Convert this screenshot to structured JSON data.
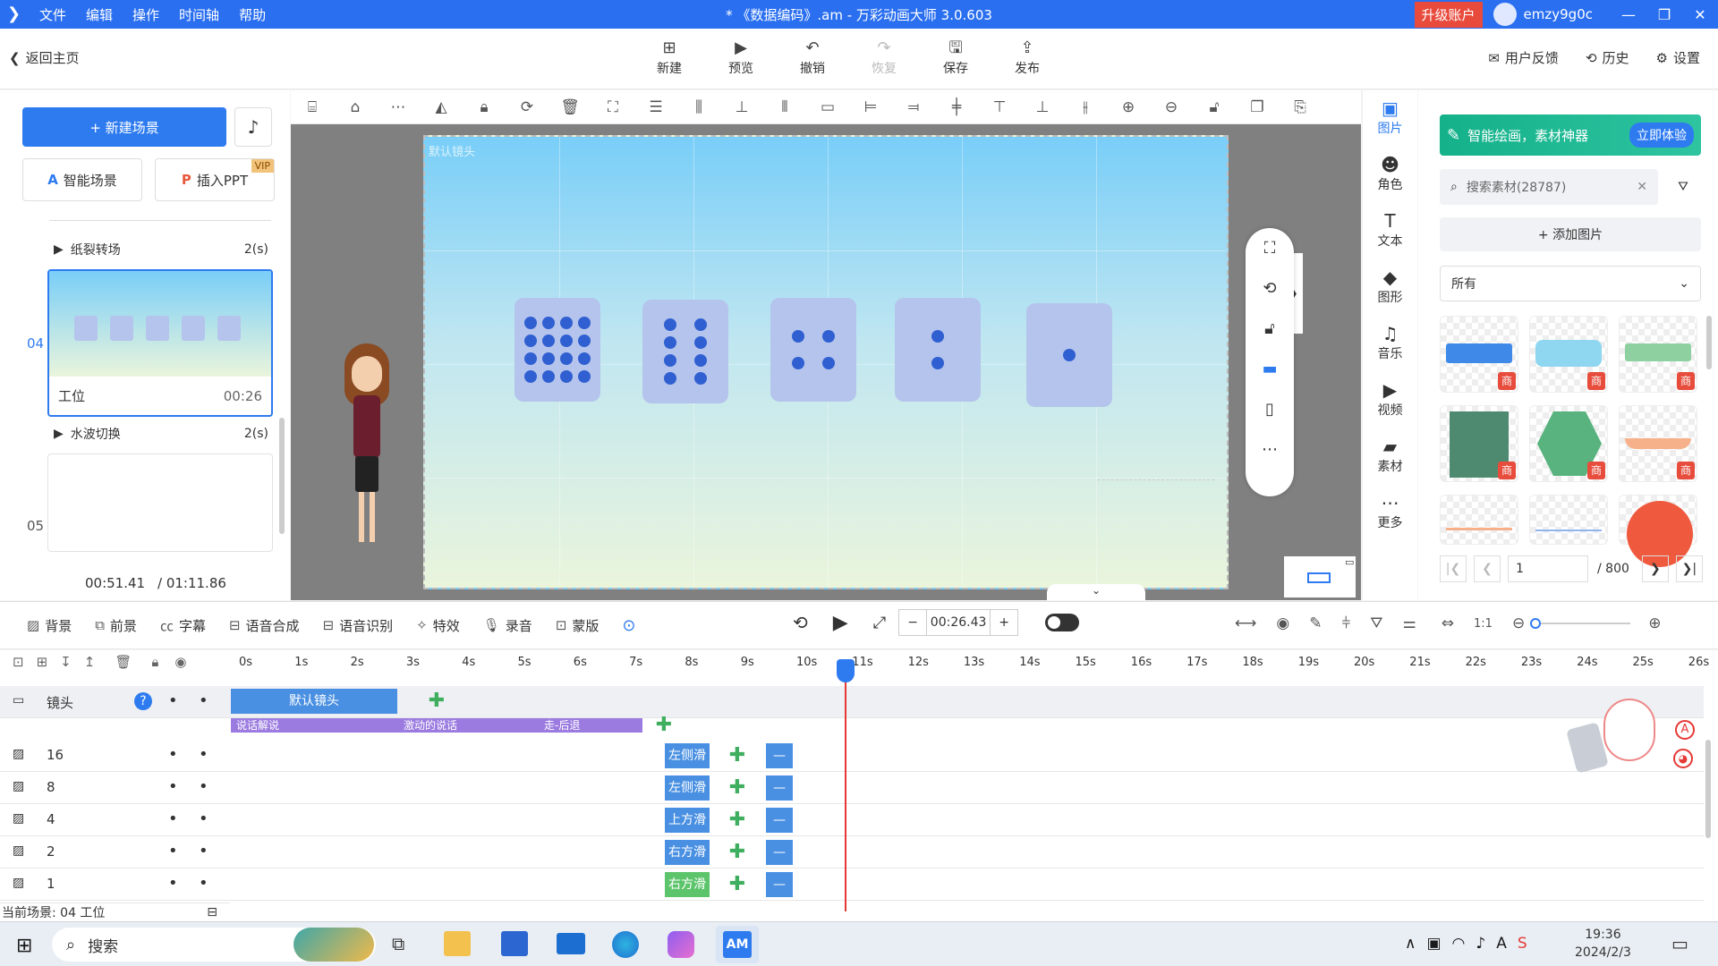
{
  "titlebar": {
    "menu": [
      "文件",
      "编辑",
      "操作",
      "时间轴",
      "帮助"
    ],
    "title": "* 《数据编码》.am - 万彩动画大师 3.0.603",
    "upgrade": "升级账户",
    "username": "emzy9g0c"
  },
  "mainbar": {
    "back": "返回主页",
    "buttons": [
      {
        "label": "新建",
        "icon": "plus-square-icon"
      },
      {
        "label": "预览",
        "icon": "play-icon"
      },
      {
        "label": "撤销",
        "icon": "undo-icon"
      },
      {
        "label": "恢复",
        "icon": "redo-icon"
      },
      {
        "label": "保存",
        "icon": "save-icon"
      },
      {
        "label": "发布",
        "icon": "publish-icon"
      }
    ],
    "feedback": "用户反馈",
    "history": "历史",
    "settings": "设置"
  },
  "leftpanel": {
    "new_scene": "+ 新建场景",
    "smart_scene": "智能场景",
    "insert_ppt": "插入PPT",
    "vip": "VIP",
    "transition1": {
      "name": "纸裂转场",
      "dur": "2(s)"
    },
    "scene04": {
      "num": "04",
      "name": "工位",
      "dur": "00:26"
    },
    "transition2": {
      "name": "水波切换",
      "dur": "2(s)"
    },
    "scene05": {
      "num": "05"
    },
    "time_current": "00:51.41",
    "time_total": "/ 01:11.86"
  },
  "stage": {
    "camera_label": "默认镜头",
    "dice": [
      16,
      8,
      4,
      2,
      1
    ]
  },
  "categories": [
    {
      "label": "图片",
      "icon": "image-icon",
      "active": true
    },
    {
      "label": "角色",
      "icon": "person-icon"
    },
    {
      "label": "文本",
      "icon": "text-icon"
    },
    {
      "label": "图形",
      "icon": "shape-icon"
    },
    {
      "label": "音乐",
      "icon": "music-icon"
    },
    {
      "label": "视频",
      "icon": "video-icon"
    },
    {
      "label": "素材",
      "icon": "folder-icon"
    },
    {
      "label": "更多",
      "icon": "more-icon"
    }
  ],
  "assets": {
    "banner_text": "智能绘画，素材神器",
    "banner_btn": "立即体验",
    "search_placeholder": "搜索素材(28787)",
    "add_image": "+ 添加图片",
    "filter": "所有",
    "shang": "商",
    "page": "1",
    "total_pages": "/ 800"
  },
  "tltools": {
    "items": [
      "背景",
      "前景",
      "字幕",
      "语音合成",
      "语音识别",
      "特效",
      "录音",
      "蒙版"
    ],
    "time": "00:26.43"
  },
  "timeline": {
    "ticks": [
      "0s",
      "1s",
      "2s",
      "3s",
      "4s",
      "5s",
      "6s",
      "7s",
      "8s",
      "9s",
      "10s",
      "11s",
      "12s",
      "13s",
      "14s",
      "15s",
      "16s",
      "17s",
      "18s",
      "19s",
      "20s",
      "21s",
      "22s",
      "23s",
      "24s",
      "25s",
      "26s"
    ],
    "camera_track": "镜头",
    "camera_clip": "默认镜头",
    "actions": [
      "说话解说",
      "激动的说话",
      "走-后退"
    ],
    "tracks": [
      {
        "name": "16",
        "clip": "左侧滑"
      },
      {
        "name": "8",
        "clip": "左侧滑"
      },
      {
        "name": "4",
        "clip": "上方滑"
      },
      {
        "name": "2",
        "clip": "右方滑"
      },
      {
        "name": "1",
        "clip": "右方滑"
      }
    ],
    "status": "当前场景: 04   工位"
  },
  "taskbar": {
    "search": "搜索",
    "app_label": "AM",
    "time": "19:36",
    "date": "2024/2/3"
  }
}
